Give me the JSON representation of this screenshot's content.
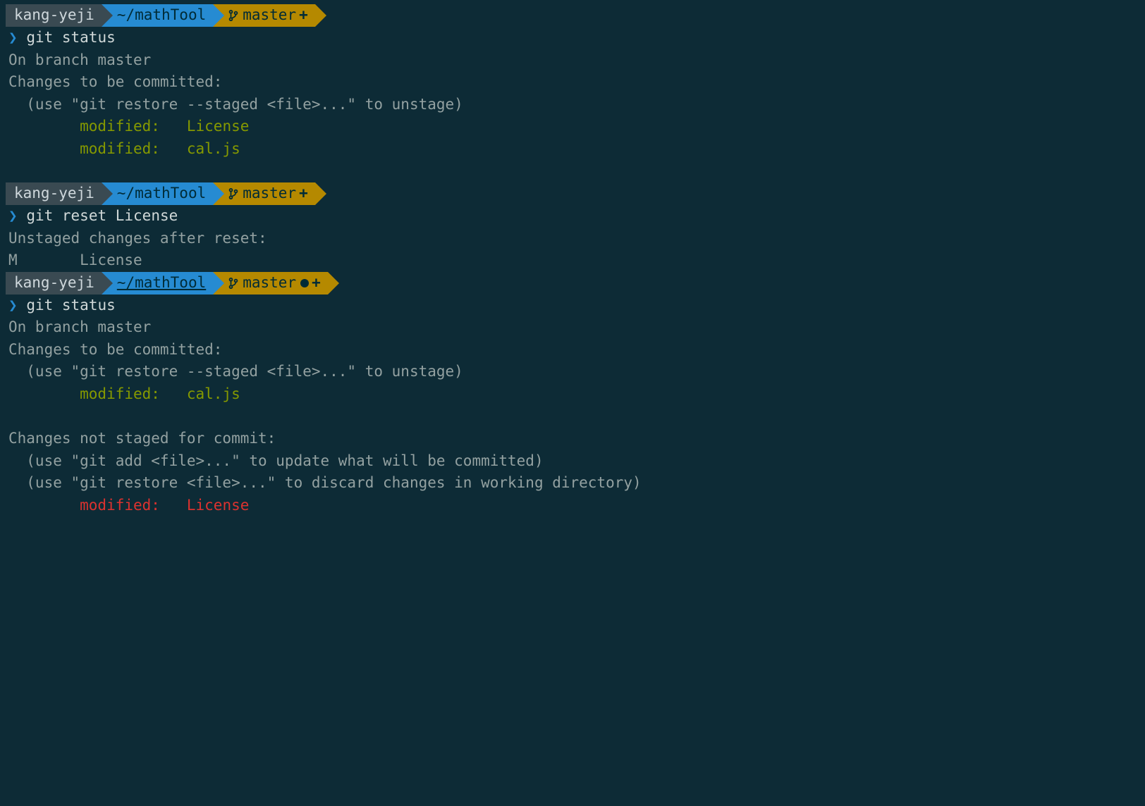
{
  "prompt": {
    "user": "kang-yeji",
    "path": "~/mathTool",
    "branch": "master",
    "status_plus": "+",
    "status_dotplus": "●+"
  },
  "block1": {
    "cmd": "git status",
    "l1": "On branch master",
    "l2": "Changes to be committed:",
    "l3": "  (use \"git restore --staged <file>...\" to unstage)",
    "l4a": "        modified:   ",
    "l4b": "License",
    "l5a": "        modified:   ",
    "l5b": "cal.js"
  },
  "block2": {
    "cmd": "git reset License",
    "l1": "Unstaged changes after reset:",
    "l2": "M       License"
  },
  "block3": {
    "cmd": "git status",
    "l1": "On branch master",
    "l2": "Changes to be committed:",
    "l3": "  (use \"git restore --staged <file>...\" to unstage)",
    "l4a": "        modified:   ",
    "l4b": "cal.js",
    "l5": "Changes not staged for commit:",
    "l6": "  (use \"git add <file>...\" to update what will be committed)",
    "l7": "  (use \"git restore <file>...\" to discard changes in working directory)",
    "l8a": "        modified:   ",
    "l8b": "License"
  },
  "glyph": {
    "chevron": "❯"
  }
}
